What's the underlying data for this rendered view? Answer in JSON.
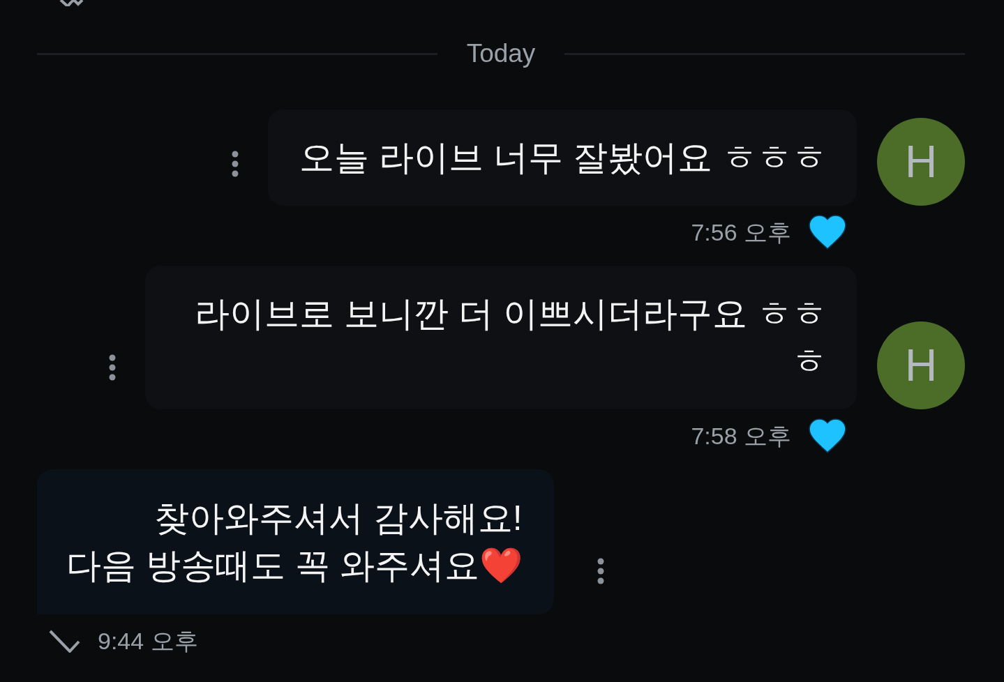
{
  "date_divider": {
    "label": "Today"
  },
  "messages": [
    {
      "kind": "received",
      "avatar": "H",
      "text": "오늘 라이브 너무 잘봤어요 ㅎㅎㅎ",
      "liked": true,
      "time": "7:56 오후"
    },
    {
      "kind": "received",
      "avatar": "H",
      "text": "라이브로 보니깐 더 이쁘시더라구요 ㅎㅎㅎ",
      "liked": true,
      "time": "7:58 오후"
    },
    {
      "kind": "sent",
      "text": "찾아와주셔서 감사해요!\n다음 방송때도 꼭 와주셔요❤️",
      "read": true,
      "time": "9:44 오후"
    }
  ]
}
